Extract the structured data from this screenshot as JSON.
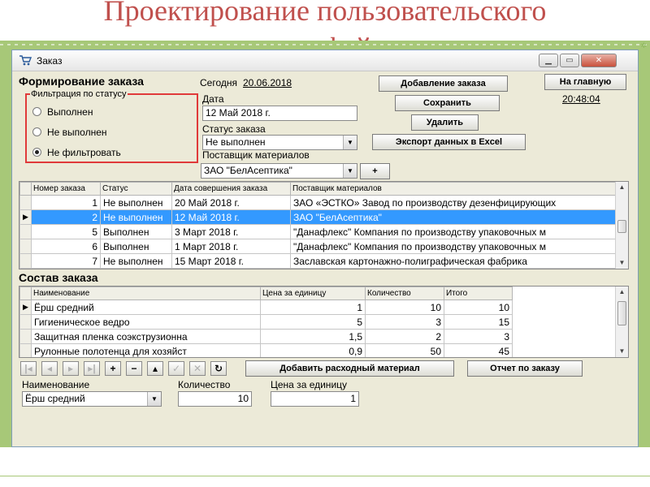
{
  "slide": {
    "title_line1": "Проектирование пользовательского",
    "title_line2": "интерфейса"
  },
  "window": {
    "title": "Заказ",
    "controls": [
      "minimize",
      "maximize",
      "close"
    ]
  },
  "form": {
    "heading": "Формирование заказа",
    "today_label": "Сегодня",
    "today_value": "20.06.2018",
    "filter": {
      "legend": "Фильтрация по статусу",
      "options": [
        "Выполнен",
        "Не выполнен",
        "Не фильтровать"
      ],
      "selected": "Не фильтровать"
    },
    "date_label": "Дата",
    "date_value": "12 Май 2018 г.",
    "status_label": "Статус заказа",
    "status_value": "Не выполнен",
    "supplier_label": "Поставщик материалов",
    "supplier_value": "ЗАО \"БелАсептика\"",
    "add_supplier_label": "+",
    "buttons": {
      "add_order": "Добавление заказа",
      "save": "Сохранить",
      "delete": "Удалить",
      "export": "Экспорт данных в Excel",
      "home": "На главную"
    },
    "clock": "20:48:04"
  },
  "orders_grid": {
    "columns": [
      "Номер заказа",
      "Статус",
      "Дата совершения заказа",
      "Поставщик материалов"
    ],
    "rows": [
      {
        "num": "1",
        "status": "Не выполнен",
        "date": "20 Май 2018 г.",
        "supplier": "ЗАО «ЭСТКО» Завод по производству дезенфицирующих",
        "selected": false
      },
      {
        "num": "2",
        "status": "Не выполнен",
        "date": "12 Май 2018 г.",
        "supplier": "ЗАО \"БелАсептика\"",
        "selected": true
      },
      {
        "num": "5",
        "status": "Выполнен",
        "date": "3 Март 2018 г.",
        "supplier": "\"Данафлекс\" Компания по производству упаковочных м",
        "selected": false
      },
      {
        "num": "6",
        "status": "Выполнен",
        "date": "1 Март 2018 г.",
        "supplier": "\"Данафлекс\" Компания по производству упаковочных м",
        "selected": false
      },
      {
        "num": "7",
        "status": "Не выполнен",
        "date": "15 Март 2018 г.",
        "supplier": "Заславская картонажно-полиграфическая фабрика",
        "selected": false
      }
    ]
  },
  "composition": {
    "heading": "Состав заказа",
    "columns": [
      "Наименование",
      "Цена за единицу",
      "Количество",
      "Итого"
    ],
    "rows": [
      {
        "name": "Ёрш средний",
        "price": "1",
        "qty": "10",
        "total": "10",
        "current": true
      },
      {
        "name": "Гигиеническое ведро",
        "price": "5",
        "qty": "3",
        "total": "15",
        "current": false
      },
      {
        "name": "Защитная пленка соэкструзионна",
        "price": "1,5",
        "qty": "2",
        "total": "3",
        "current": false
      },
      {
        "name": "Рулонные полотенца для хозяйст",
        "price": "0,9",
        "qty": "50",
        "total": "45",
        "current": false
      }
    ]
  },
  "navigator": {
    "buttons": [
      {
        "symbol": "|◂",
        "enabled": false,
        "icon": "first-record-icon"
      },
      {
        "symbol": "◂",
        "enabled": false,
        "icon": "prior-record-icon"
      },
      {
        "symbol": "▸",
        "enabled": false,
        "icon": "next-record-icon"
      },
      {
        "symbol": "▸|",
        "enabled": false,
        "icon": "last-record-icon"
      },
      {
        "symbol": "+",
        "enabled": true,
        "icon": "insert-icon"
      },
      {
        "symbol": "−",
        "enabled": true,
        "icon": "delete-icon"
      },
      {
        "symbol": "▴",
        "enabled": true,
        "icon": "edit-icon"
      },
      {
        "symbol": "✓",
        "enabled": false,
        "icon": "post-icon"
      },
      {
        "symbol": "✕",
        "enabled": false,
        "icon": "cancel-icon"
      },
      {
        "symbol": "↻",
        "enabled": true,
        "icon": "refresh-icon"
      }
    ],
    "add_material": "Добавить расходный материал",
    "order_report": "Отчет по заказу"
  },
  "material_form": {
    "name_label": "Наименование",
    "name_value": "Ёрш средний",
    "qty_label": "Количество",
    "qty_value": "10",
    "price_label": "Цена за единицу",
    "price_value": "1"
  },
  "colors": {
    "title": "#c0504d",
    "accent_green": "#a7c878",
    "highlight": "#e03a3a",
    "selection": "#3399ff"
  }
}
